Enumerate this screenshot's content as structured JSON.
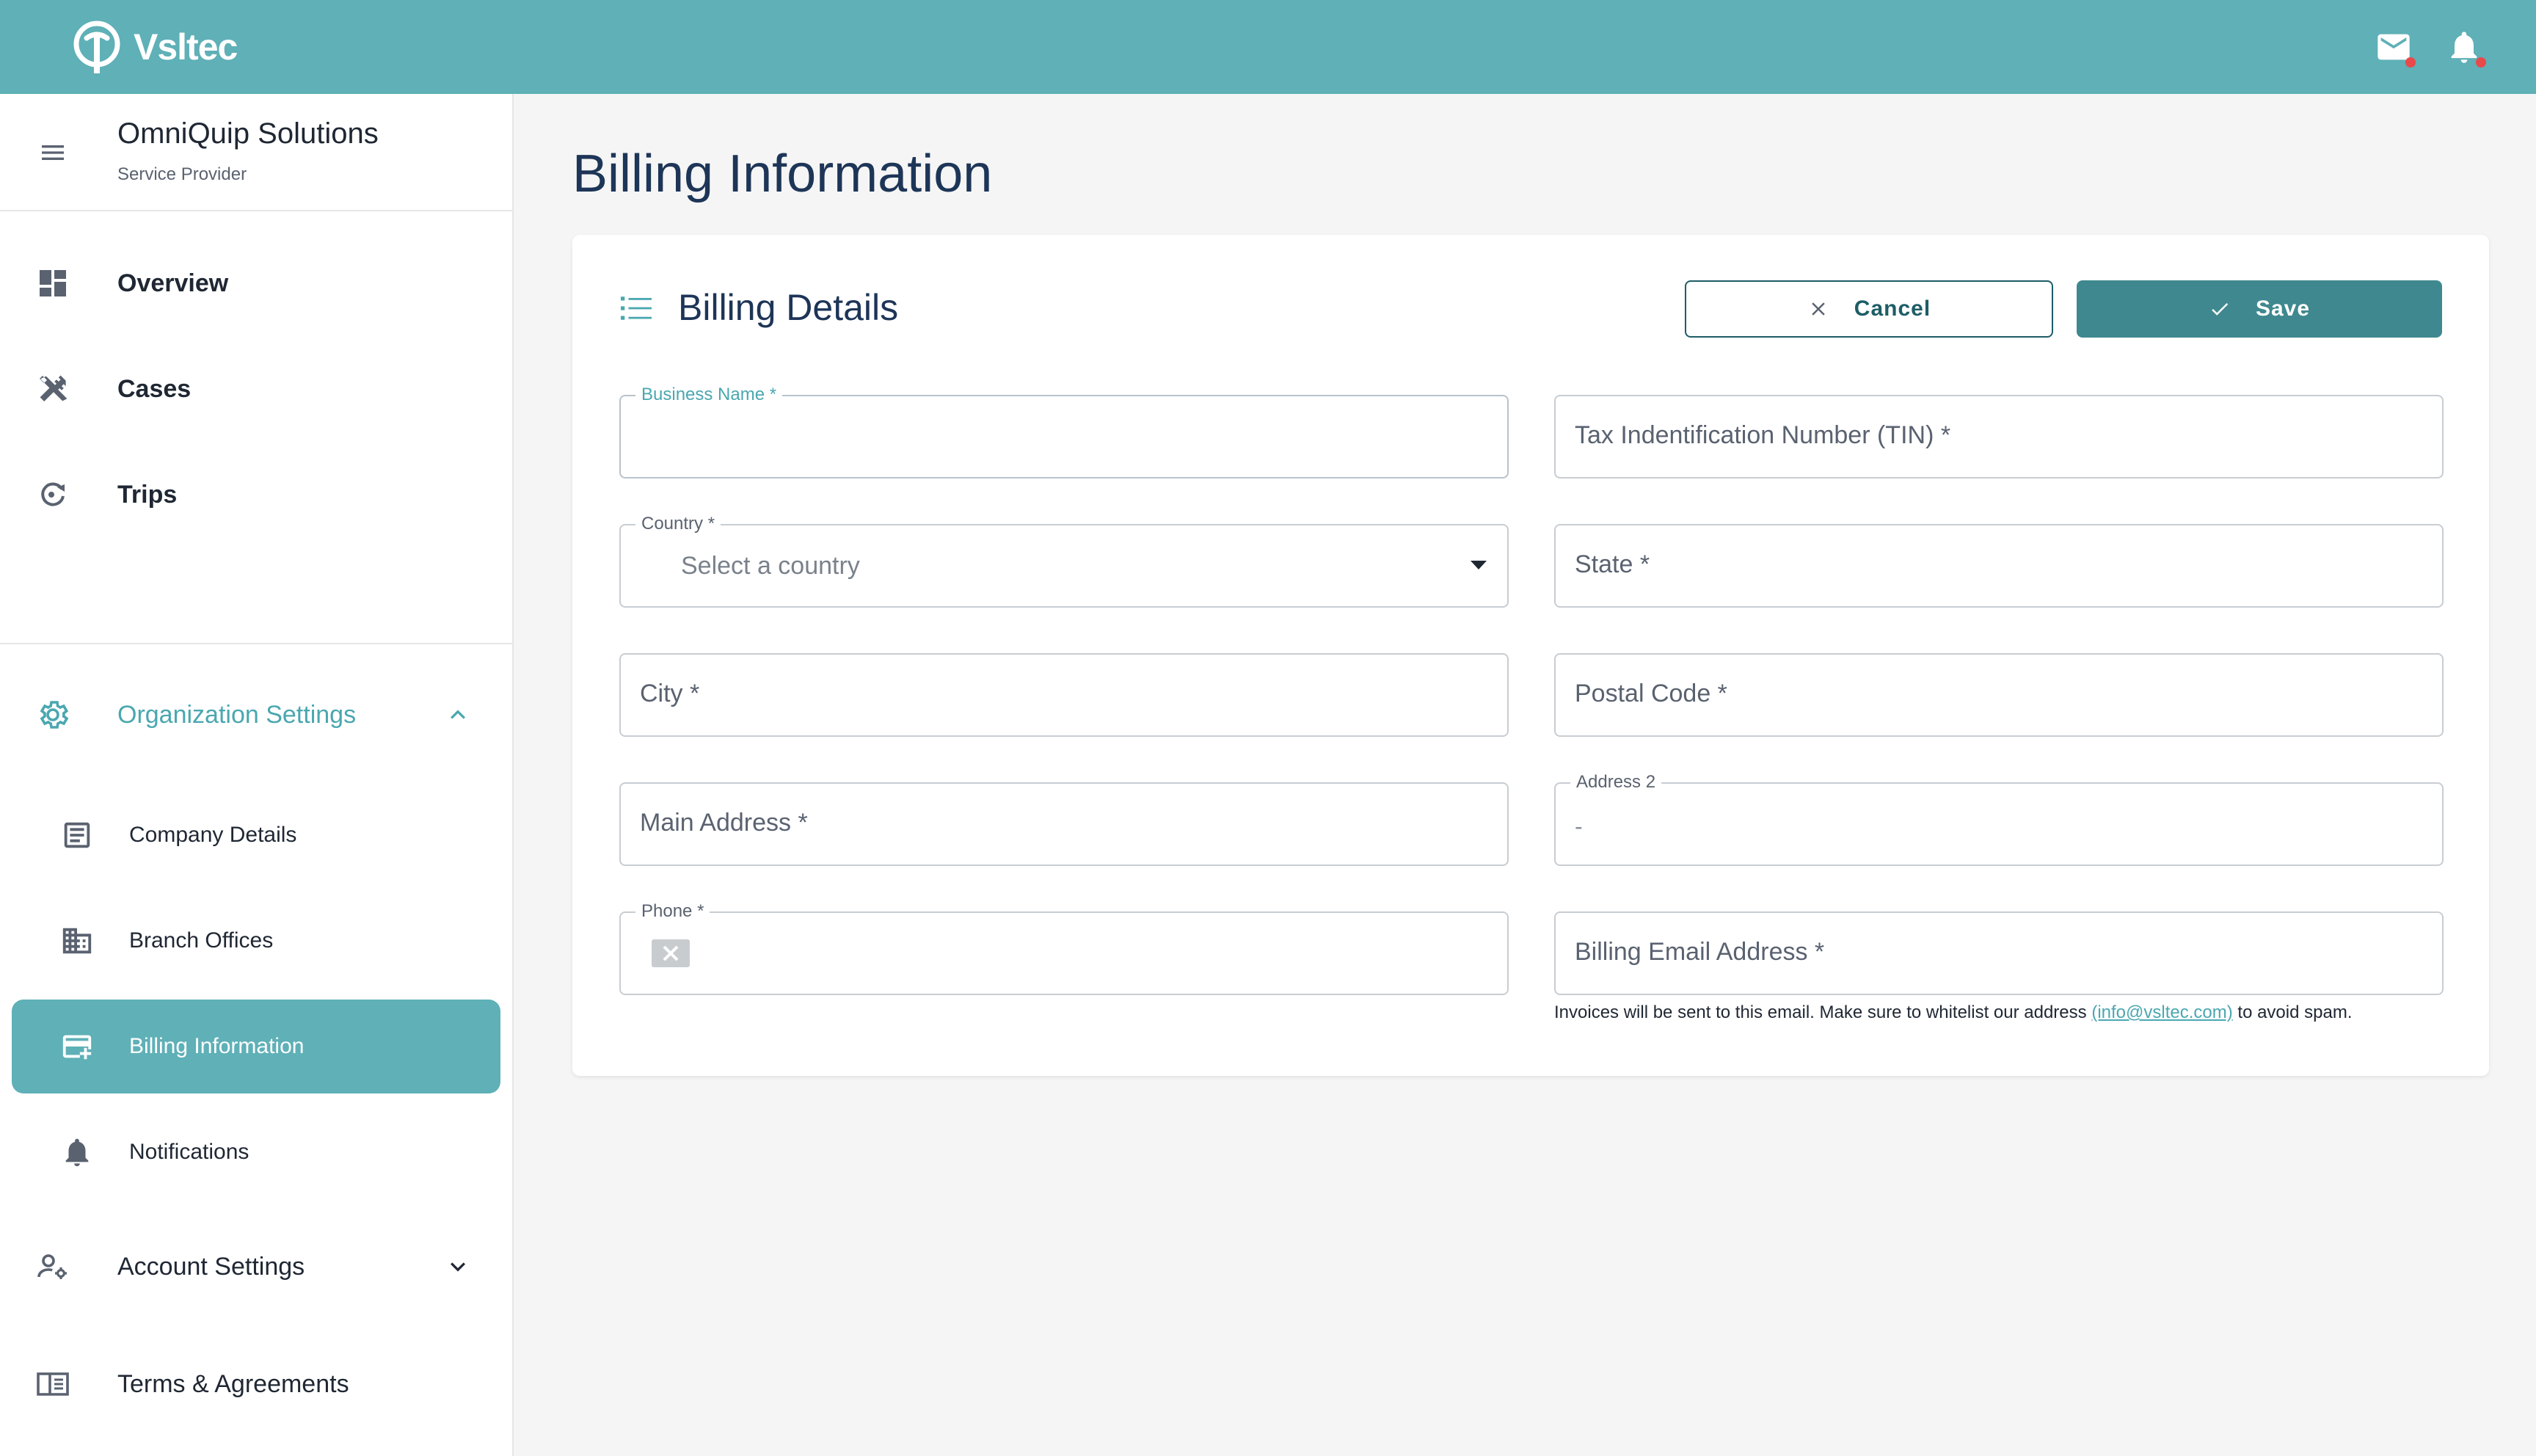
{
  "app": {
    "brand": "Vsltec"
  },
  "topbar": {
    "mail_icon": "mail-icon",
    "bell_icon": "bell-icon"
  },
  "sidebar": {
    "org_name": "OmniQuip Solutions",
    "org_role": "Service Provider",
    "nav": [
      {
        "label": "Overview",
        "icon": "dashboard-icon"
      },
      {
        "label": "Cases",
        "icon": "tools-icon"
      },
      {
        "label": "Trips",
        "icon": "trip-icon"
      }
    ],
    "org_settings": {
      "label": "Organization Settings",
      "expanded": true,
      "items": [
        {
          "label": "Company Details",
          "icon": "document-icon"
        },
        {
          "label": "Branch Offices",
          "icon": "building-icon"
        },
        {
          "label": "Billing Information",
          "icon": "credit-card-icon",
          "active": true
        },
        {
          "label": "Notifications",
          "icon": "bell-icon"
        }
      ]
    },
    "account_settings": {
      "label": "Account Settings",
      "expanded": false
    },
    "terms": {
      "label": "Terms & Agreements"
    }
  },
  "page": {
    "title": "Billing Information"
  },
  "card": {
    "title": "Billing Details",
    "cancel_label": "Cancel",
    "save_label": "Save",
    "fields": {
      "business_name": {
        "label": "Business Name *",
        "value": ""
      },
      "tin": {
        "placeholder": "Tax Indentification Number (TIN) *"
      },
      "country": {
        "label": "Country *",
        "placeholder": "Select a country"
      },
      "state": {
        "placeholder": "State *"
      },
      "city": {
        "placeholder": "City *"
      },
      "postal_code": {
        "placeholder": "Postal Code *"
      },
      "main_address": {
        "placeholder": "Main Address *"
      },
      "address2": {
        "label": "Address 2",
        "value": "-"
      },
      "phone": {
        "label": "Phone *"
      },
      "billing_email": {
        "placeholder": "Billing Email Address *"
      }
    },
    "hint": {
      "before": "Invoices will be sent to this email. Make sure to whitelist our address ",
      "link": "(info@vsltec.com)",
      "after": " to avoid spam."
    }
  },
  "colors": {
    "primary": "#5fb0b7",
    "primary_dark": "#3f888f",
    "title": "#1d3557"
  }
}
